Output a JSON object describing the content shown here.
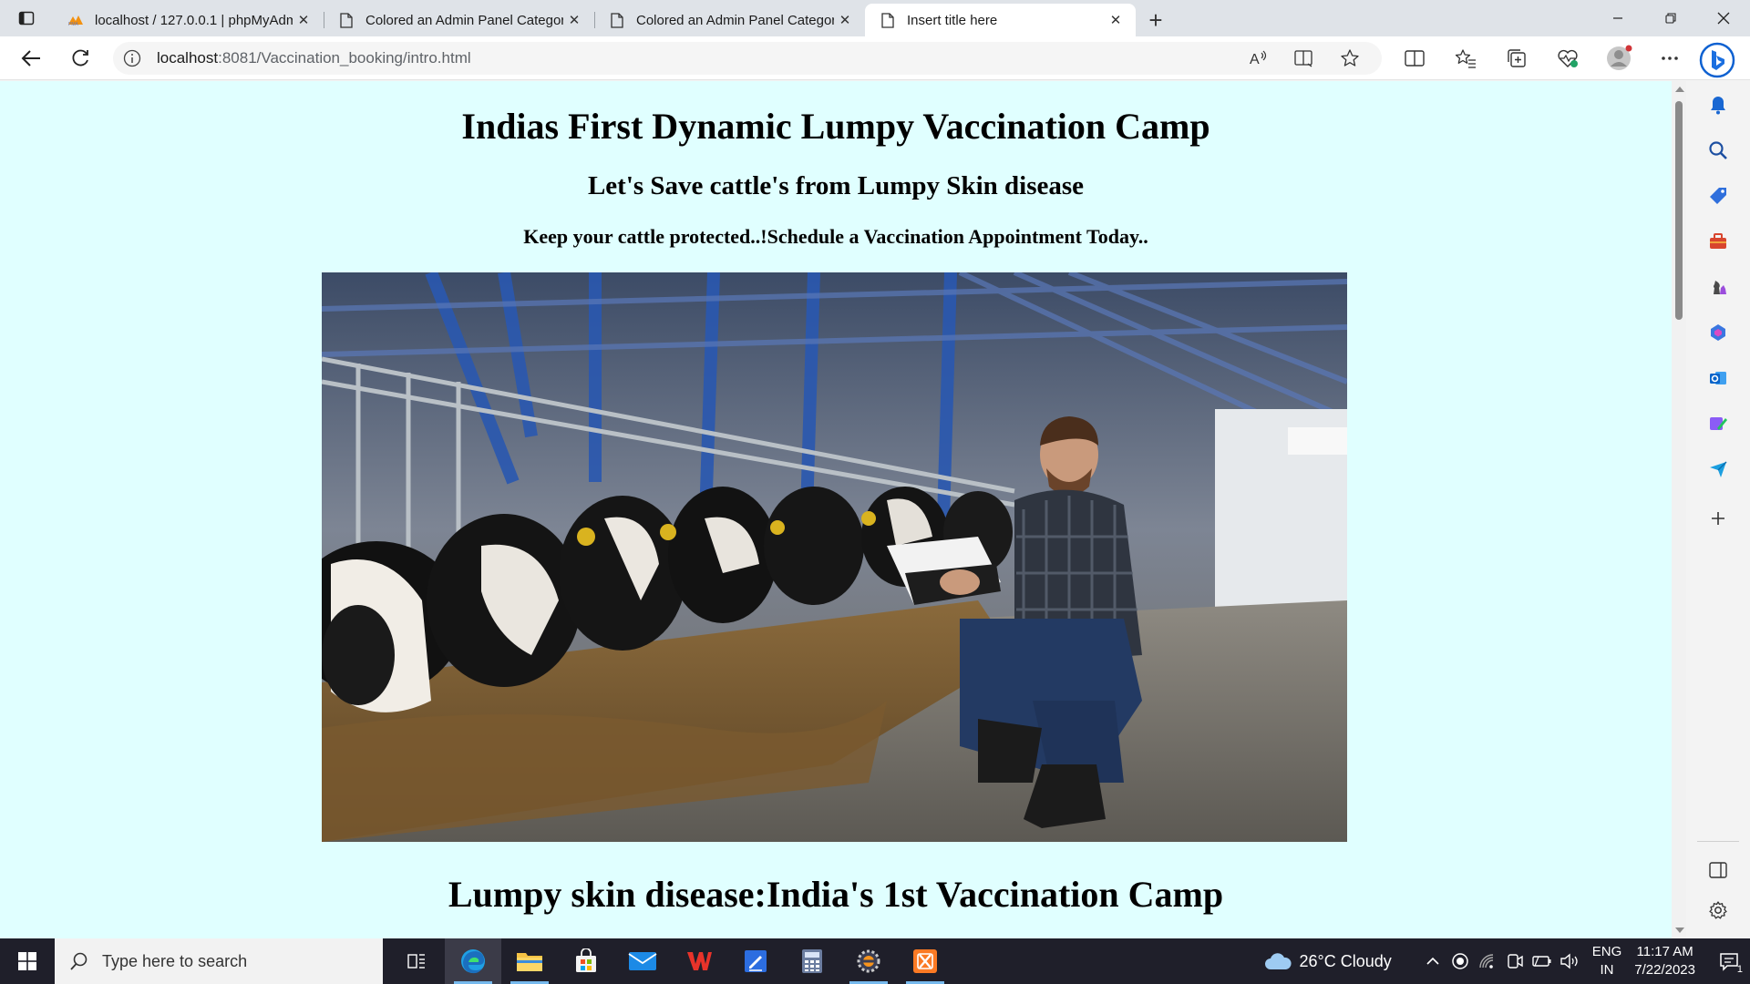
{
  "browser": {
    "tabs": [
      {
        "title": "localhost / 127.0.0.1 | phpMyAdm",
        "icon": "phpmyadmin-icon"
      },
      {
        "title": "Colored an Admin Panel Categor",
        "icon": "page-icon"
      },
      {
        "title": "Colored an Admin Panel Categor",
        "icon": "page-icon"
      },
      {
        "title": "Insert title here",
        "icon": "page-icon",
        "active": true
      }
    ],
    "url_host": "localhost",
    "url_path": ":8081/Vaccination_booking/intro.html"
  },
  "page": {
    "background": "#e0ffff",
    "title": "Indias First Dynamic Lumpy Vaccination Camp",
    "subtitle": "Let's Save cattle's from Lumpy Skin disease",
    "tagline": "Keep your cattle protected..!Schedule a Vaccination Appointment Today..",
    "hero_image": "farmer-with-clipboard-and-cows-in-barn",
    "section_title": "Lumpy skin disease:India's 1st Vaccination Camp"
  },
  "taskbar": {
    "search_placeholder": "Type here to search",
    "weather": "26°C  Cloudy",
    "language_top": "ENG",
    "language_bottom": "IN",
    "time": "11:17 AM",
    "date": "7/22/2023",
    "notification_count": "1"
  }
}
